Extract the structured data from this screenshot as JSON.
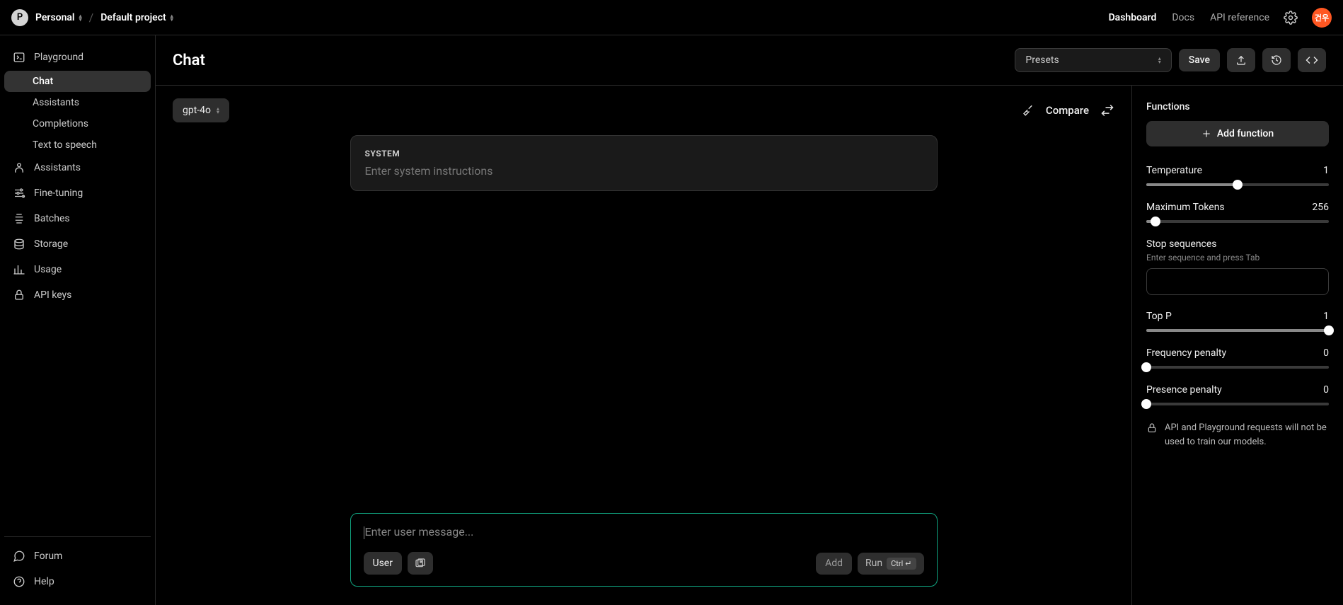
{
  "breadcrumb": {
    "org_initial": "P",
    "org": "Personal",
    "project": "Default project"
  },
  "topnav": {
    "dashboard": "Dashboard",
    "docs": "Docs",
    "api_ref": "API reference"
  },
  "avatar_text": "건우",
  "sidebar": {
    "playground": "Playground",
    "subs": [
      "Chat",
      "Assistants",
      "Completions",
      "Text to speech"
    ],
    "items": [
      "Assistants",
      "Fine-tuning",
      "Batches",
      "Storage",
      "Usage",
      "API keys"
    ],
    "bottom": [
      "Forum",
      "Help"
    ]
  },
  "header": {
    "title": "Chat",
    "presets": "Presets",
    "save": "Save"
  },
  "chat": {
    "model": "gpt-4o",
    "compare": "Compare",
    "system_label": "SYSTEM",
    "system_placeholder": "Enter system instructions",
    "user_placeholder": "Enter user message...",
    "user_pill": "User",
    "add": "Add",
    "run": "Run",
    "run_key": "Ctrl",
    "run_key2": "↵"
  },
  "panel": {
    "functions_title": "Functions",
    "add_function": "Add function",
    "temperature": {
      "label": "Temperature",
      "value": "1",
      "pct": 50
    },
    "max_tokens": {
      "label": "Maximum Tokens",
      "value": "256",
      "pct": 5
    },
    "stop": {
      "label": "Stop sequences",
      "hint": "Enter sequence and press Tab"
    },
    "top_p": {
      "label": "Top P",
      "value": "1",
      "pct": 100
    },
    "freq": {
      "label": "Frequency penalty",
      "value": "0",
      "pct": 0
    },
    "pres": {
      "label": "Presence penalty",
      "value": "0",
      "pct": 0
    },
    "notice": "API and Playground requests will not be used to train our models."
  }
}
